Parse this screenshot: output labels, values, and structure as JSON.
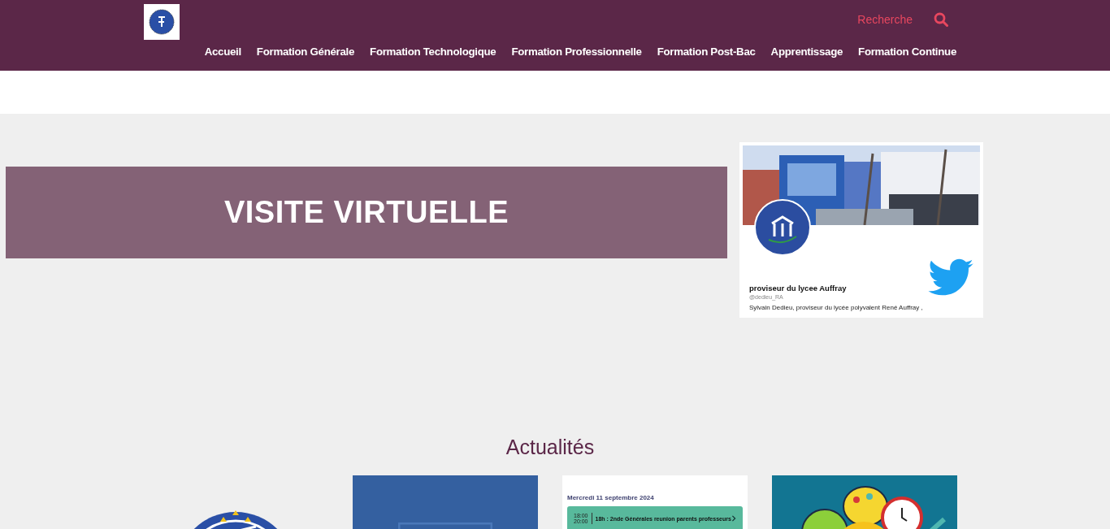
{
  "header": {
    "search_label": "Recherche",
    "nav": [
      "Accueil",
      "Formation Générale",
      "Formation Technologique",
      "Formation Professionnelle",
      "Formation Post-Bac",
      "Apprentissage",
      "Formation Continue"
    ]
  },
  "banner": {
    "title": "VISITE VIRTUELLE"
  },
  "twitter_card": {
    "name": "proviseur du lycee Auffray",
    "handle": "@dedieu_RA",
    "bio": "Sylvain Dedieu, proviseur du lycée polyvalent René Auffray ,"
  },
  "news": {
    "title": "Actualités",
    "cards": [
      {
        "kind": "logo"
      },
      {
        "kind": "placeholder"
      },
      {
        "kind": "calendar",
        "date": "Mercredi 11 septembre 2024",
        "events": [
          {
            "start": "18:00",
            "end": "20:00",
            "title": "18h : 2nde Générales reunion parents professeurs"
          }
        ]
      },
      {
        "kind": "picture"
      }
    ]
  }
}
